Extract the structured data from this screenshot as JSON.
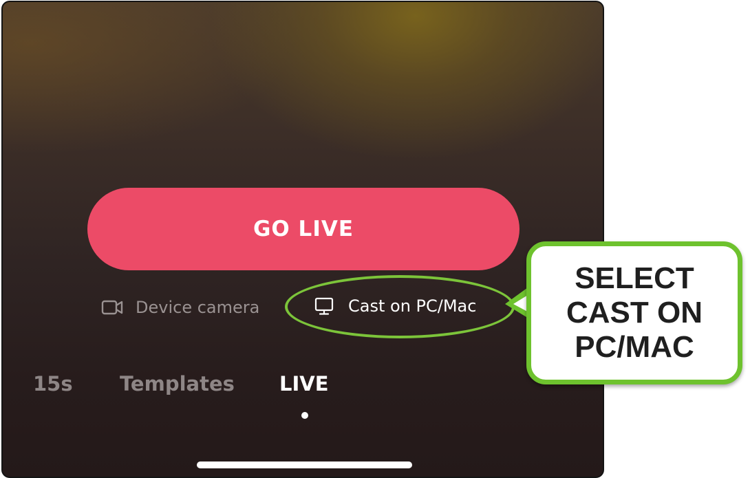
{
  "main": {
    "go_live_label": "GO LIVE",
    "source_options": [
      {
        "label": "Device camera",
        "icon": "video-camera-icon"
      },
      {
        "label": "Cast on PC/Mac",
        "icon": "monitor-icon"
      }
    ]
  },
  "mode_tabs": [
    {
      "label": "15s",
      "active": false
    },
    {
      "label": "Templates",
      "active": false
    },
    {
      "label": "LIVE",
      "active": true
    }
  ],
  "annotation": {
    "callout_text": "SELECT CAST ON PC/MAC"
  },
  "colors": {
    "go_live_button": "#ec4b67",
    "annotation_green": "#6ec22e",
    "active_text": "#ffffff",
    "inactive_text": "#8e8686"
  }
}
